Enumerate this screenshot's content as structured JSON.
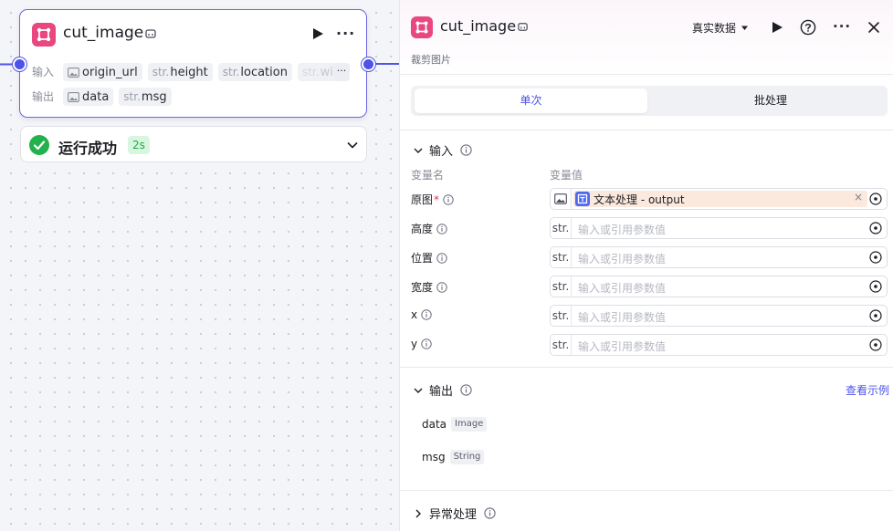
{
  "node": {
    "title": "cut_image",
    "input_label": "输入",
    "output_label": "输出",
    "inputs": [
      {
        "prefix": "",
        "name": "origin_url",
        "icon": "image-icon"
      },
      {
        "prefix": "str.",
        "name": "height"
      },
      {
        "prefix": "str.",
        "name": "location"
      },
      {
        "prefix": "str.",
        "name": "wi"
      }
    ],
    "more_label": "···",
    "outputs": [
      {
        "prefix": "",
        "name": "data",
        "icon": "image-icon"
      },
      {
        "prefix": "str.",
        "name": "msg"
      }
    ]
  },
  "status": {
    "text": "运行成功",
    "duration": "2s"
  },
  "panel": {
    "title": "cut_image",
    "description": "裁剪图片",
    "data_mode": "真实数据",
    "tabs": [
      {
        "label": "单次",
        "active": true
      },
      {
        "label": "批处理",
        "active": false
      }
    ],
    "input_section": "输入",
    "col_name": "变量名",
    "col_value": "变量值",
    "params": [
      {
        "label": "原图",
        "required": true,
        "type_icon": "image-icon",
        "ref": "文本处理 - output"
      },
      {
        "label": "高度",
        "type": "str.",
        "placeholder": "输入或引用参数值"
      },
      {
        "label": "位置",
        "type": "str.",
        "placeholder": "输入或引用参数值"
      },
      {
        "label": "宽度",
        "type": "str.",
        "placeholder": "输入或引用参数值"
      },
      {
        "label": "x",
        "type": "str.",
        "placeholder": "输入或引用参数值"
      },
      {
        "label": "y",
        "type": "str.",
        "placeholder": "输入或引用参数值"
      }
    ],
    "required_mark": "*",
    "ref_remove": "×",
    "output_section": "输出",
    "view_example": "查看示例",
    "outputs": [
      {
        "name": "data",
        "type": "Image"
      },
      {
        "name": "msg",
        "type": "String"
      }
    ],
    "exception_section": "异常处理"
  },
  "colors": {
    "accent": "#4d53e8",
    "brand_pink": "#e8477f",
    "success": "#1ea84a",
    "ref_chip_bg": "#fbe9dd"
  }
}
